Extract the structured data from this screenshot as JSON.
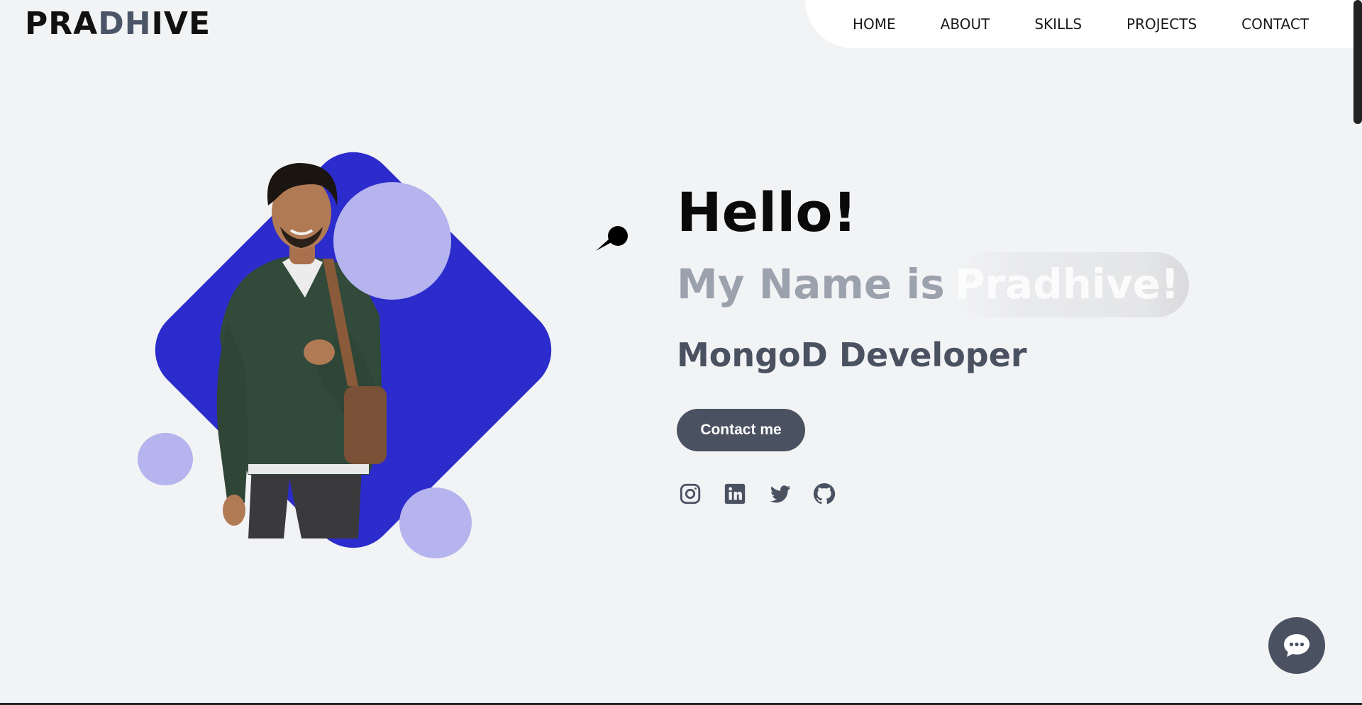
{
  "header": {
    "logo_left": "PRA",
    "logo_mid": "DH",
    "logo_right": "IVE",
    "nav": [
      "HOME",
      "ABOUT",
      "SKILLS",
      "PROJECTS",
      "CONTACT"
    ]
  },
  "hero": {
    "greeting": "Hello!",
    "name_prefix": "My Name is",
    "name_typed": "Pradhive!",
    "role": "MongoD Developer",
    "cta_label": "Contact me",
    "image_alt_icon": "person-photo",
    "socials": [
      "instagram-icon",
      "linkedin-icon",
      "twitter-icon",
      "github-icon"
    ]
  },
  "colors": {
    "accent_blue": "#2c2bcb",
    "accent_light": "#b5b4ee",
    "button_dark": "#4a5161",
    "background": "#f2f3f5"
  },
  "chat": {
    "icon": "chat-bubble-icon"
  }
}
